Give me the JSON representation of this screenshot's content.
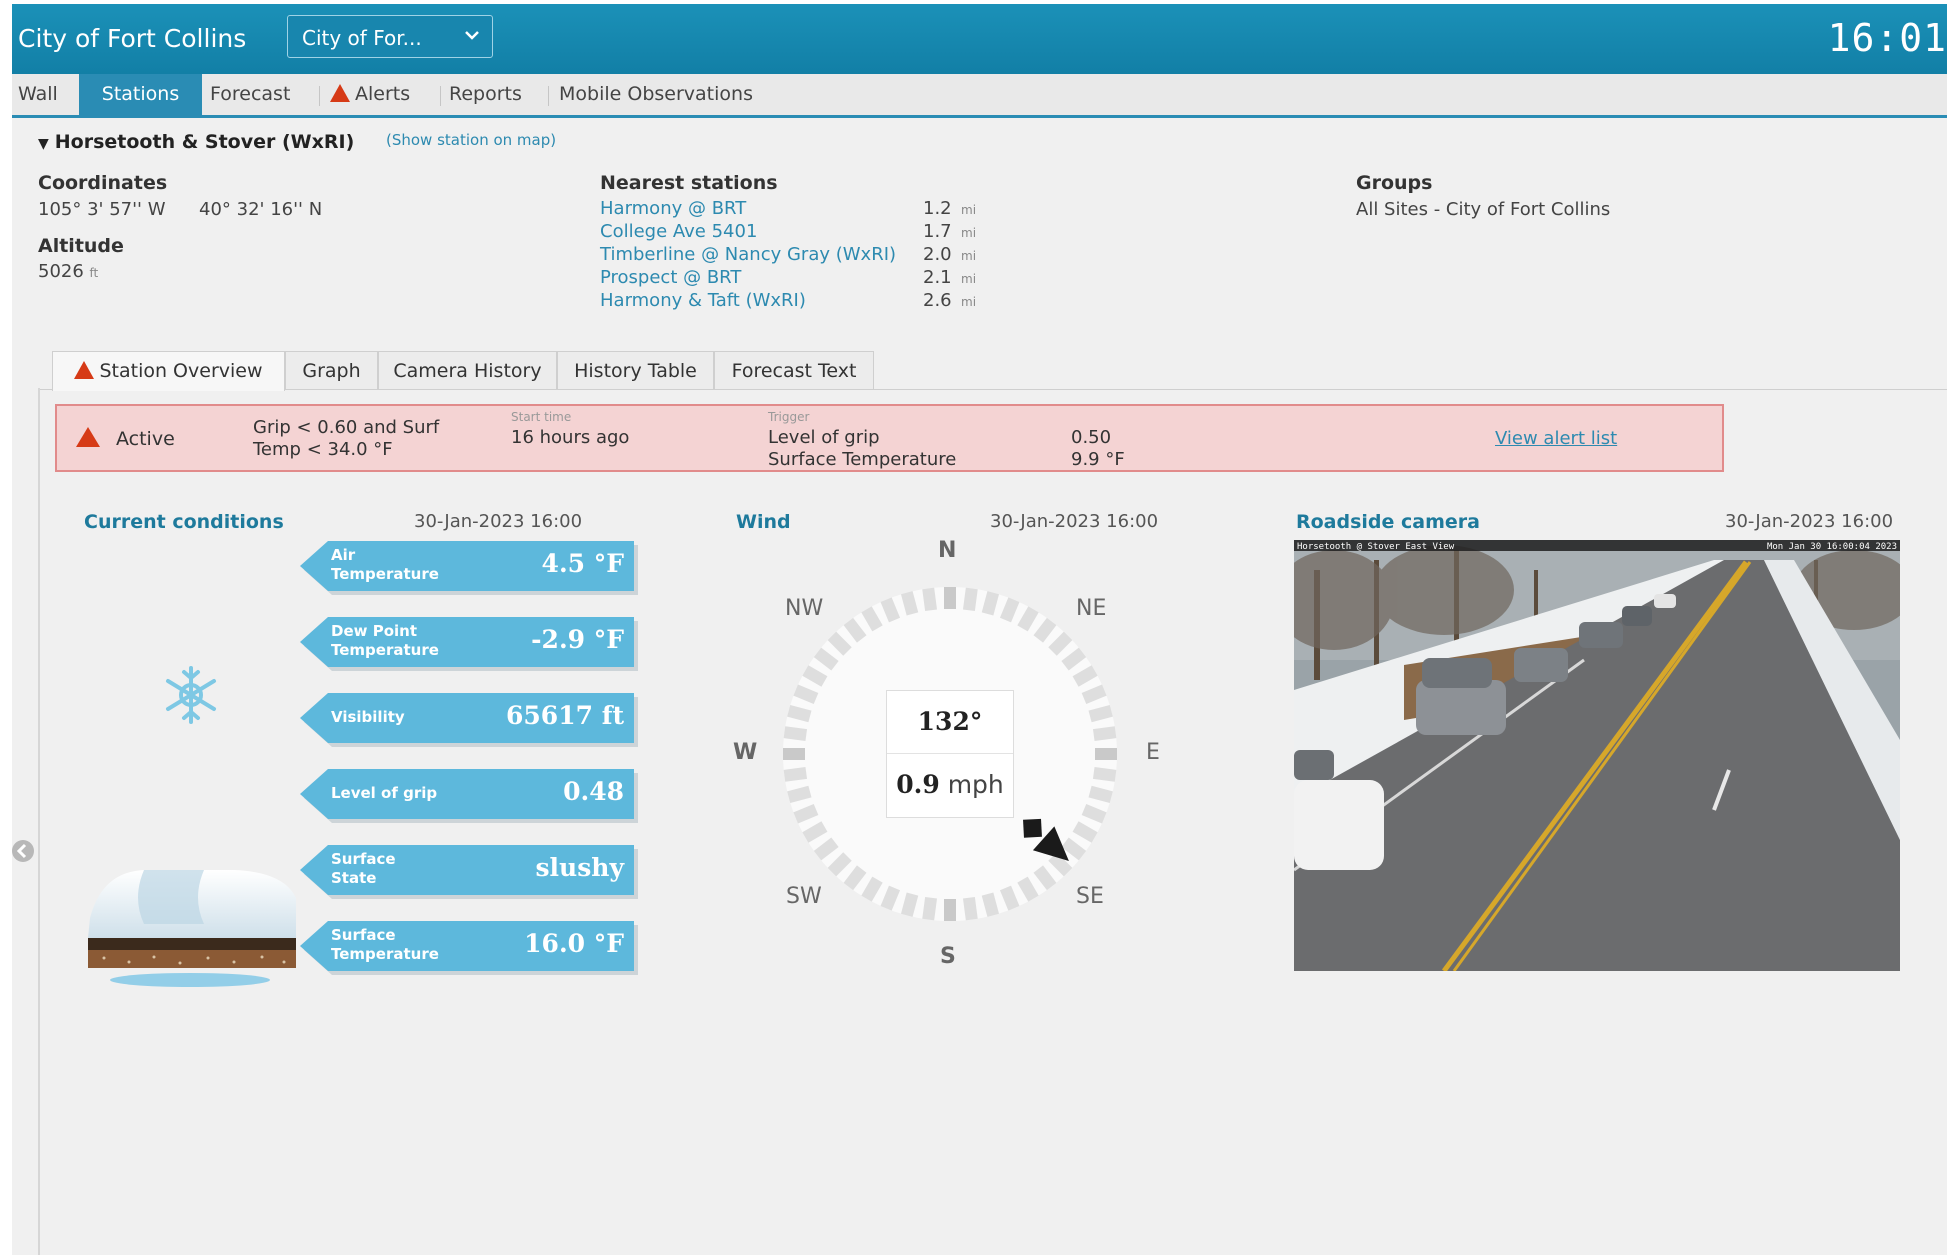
{
  "header": {
    "app_title": "City of Fort Collins",
    "site_select": "City of For...",
    "clock": "16:01"
  },
  "nav": {
    "wall": "Wall",
    "stations": "Stations",
    "forecast": "Forecast",
    "alerts": "Alerts",
    "reports": "Reports",
    "mobile": "Mobile Observations"
  },
  "station": {
    "name": "Horsetooth & Stover (WxRI)",
    "show_on_map": "(Show station on map)",
    "coordinates_label": "Coordinates",
    "longitude": "105° 3' 57'' W",
    "latitude": "40° 32' 16'' N",
    "altitude_label": "Altitude",
    "altitude_value": "5026",
    "altitude_unit": "ft",
    "nearest_label": "Nearest stations",
    "nearest": [
      {
        "name": "Harmony @ BRT",
        "dist": "1.2",
        "unit": "mi"
      },
      {
        "name": "College Ave 5401",
        "dist": "1.7",
        "unit": "mi"
      },
      {
        "name": "Timberline @ Nancy Gray (WxRI)",
        "dist": "2.0",
        "unit": "mi"
      },
      {
        "name": "Prospect @ BRT",
        "dist": "2.1",
        "unit": "mi"
      },
      {
        "name": "Harmony & Taft (WxRI)",
        "dist": "2.6",
        "unit": "mi"
      }
    ],
    "groups_label": "Groups",
    "groups_value": "All Sites - City of Fort Collins"
  },
  "tabs": {
    "overview": "Station Overview",
    "graph": "Graph",
    "camera_history": "Camera History",
    "history_table": "History Table",
    "forecast_text": "Forecast Text"
  },
  "alert": {
    "status": "Active",
    "rule": "Grip < 0.60 and Surf Temp < 34.0 °F",
    "start_label": "Start time",
    "start_value": "16 hours ago",
    "trigger_label": "Trigger",
    "trigger1_name": "Level of grip",
    "trigger1_value": "0.50",
    "trigger2_name": "Surface Temperature",
    "trigger2_value": "9.9 °F",
    "view_link": "View alert list"
  },
  "conditions": {
    "title": "Current conditions",
    "timestamp": "30-Jan-2023 16:00",
    "items": [
      {
        "label": "Air Temperature",
        "value": "4.5 °F"
      },
      {
        "label": "Dew Point Temperature",
        "value": "-2.9 °F"
      },
      {
        "label": "Visibility",
        "value": "65617 ft"
      },
      {
        "label": "Level of grip",
        "value": "0.48"
      },
      {
        "label": "Surface State",
        "value": "slushy"
      },
      {
        "label": "Surface Temperature",
        "value": "16.0 °F"
      }
    ]
  },
  "wind": {
    "title": "Wind",
    "timestamp": "30-Jan-2023 16:00",
    "direction_deg": 132,
    "direction_text": "132°",
    "speed_value": "0.9",
    "speed_unit": "mph",
    "cardinals": {
      "n": "N",
      "ne": "NE",
      "e": "E",
      "se": "SE",
      "s": "S",
      "sw": "SW",
      "w": "W",
      "nw": "NW"
    }
  },
  "camera": {
    "title": "Roadside camera",
    "timestamp": "30-Jan-2023 16:00",
    "overlay_left": "Horsetooth @ Stover East View",
    "overlay_right": "Mon Jan 30 16:00:04 2023"
  },
  "colors": {
    "header": "#1886ae",
    "accent": "#2a8cb4",
    "tile": "#5db8dc",
    "alert_bg": "#f4d3d3",
    "alert_border": "#e18b8b",
    "alert_icon": "#d63a16"
  },
  "icons": [
    "chevron-down-icon",
    "alert-triangle-icon",
    "caret-down-icon",
    "snowflake-icon",
    "road-surface-icon",
    "wind-arrow-icon",
    "collapse-arrow-icon"
  ]
}
